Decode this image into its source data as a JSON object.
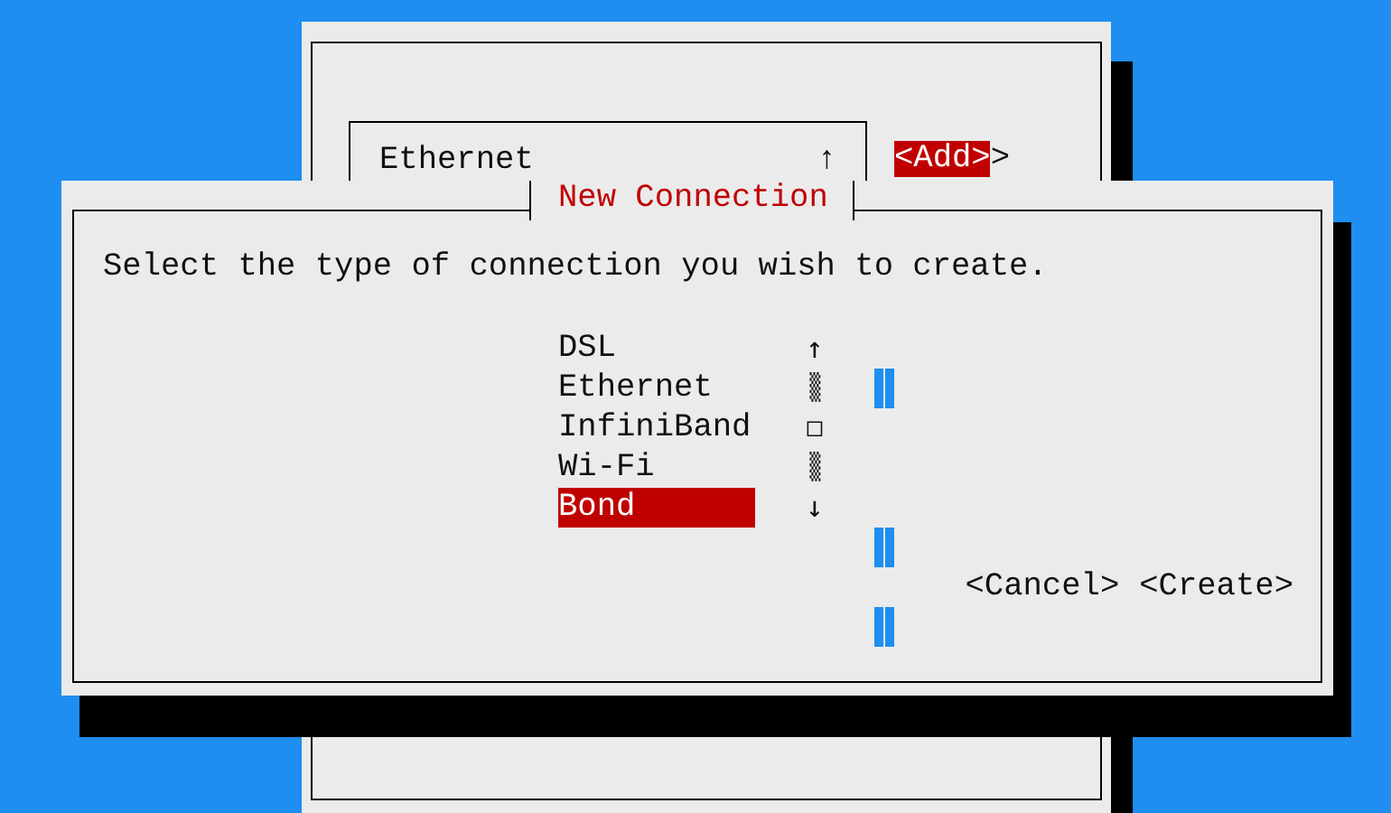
{
  "background_window": {
    "list": [
      {
        "label": "Ethernet"
      }
    ],
    "scroll_arrow": "↑",
    "buttons": [
      {
        "label": "<Add>",
        "selected": true
      },
      {
        "label": ">",
        "selected": false
      }
    ]
  },
  "dialog": {
    "title": "New Connection",
    "prompt": "Select the type of connection you wish to create.",
    "options": [
      {
        "label": "DSL",
        "selected": false
      },
      {
        "label": "Ethernet",
        "selected": false
      },
      {
        "label": "InfiniBand",
        "selected": false
      },
      {
        "label": "Wi-Fi",
        "selected": false
      },
      {
        "label": "Bond",
        "selected": true
      }
    ],
    "scrollbar": [
      {
        "kind": "up",
        "glyph": "↑"
      },
      {
        "kind": "track",
        "glyph": "▒"
      },
      {
        "kind": "thumb",
        "glyph": "□"
      },
      {
        "kind": "track",
        "glyph": "▒"
      },
      {
        "kind": "down",
        "glyph": "↓"
      }
    ],
    "buttons": [
      {
        "label": "<Cancel>",
        "selected": false
      },
      {
        "label": "<Create>",
        "selected": false
      }
    ]
  }
}
